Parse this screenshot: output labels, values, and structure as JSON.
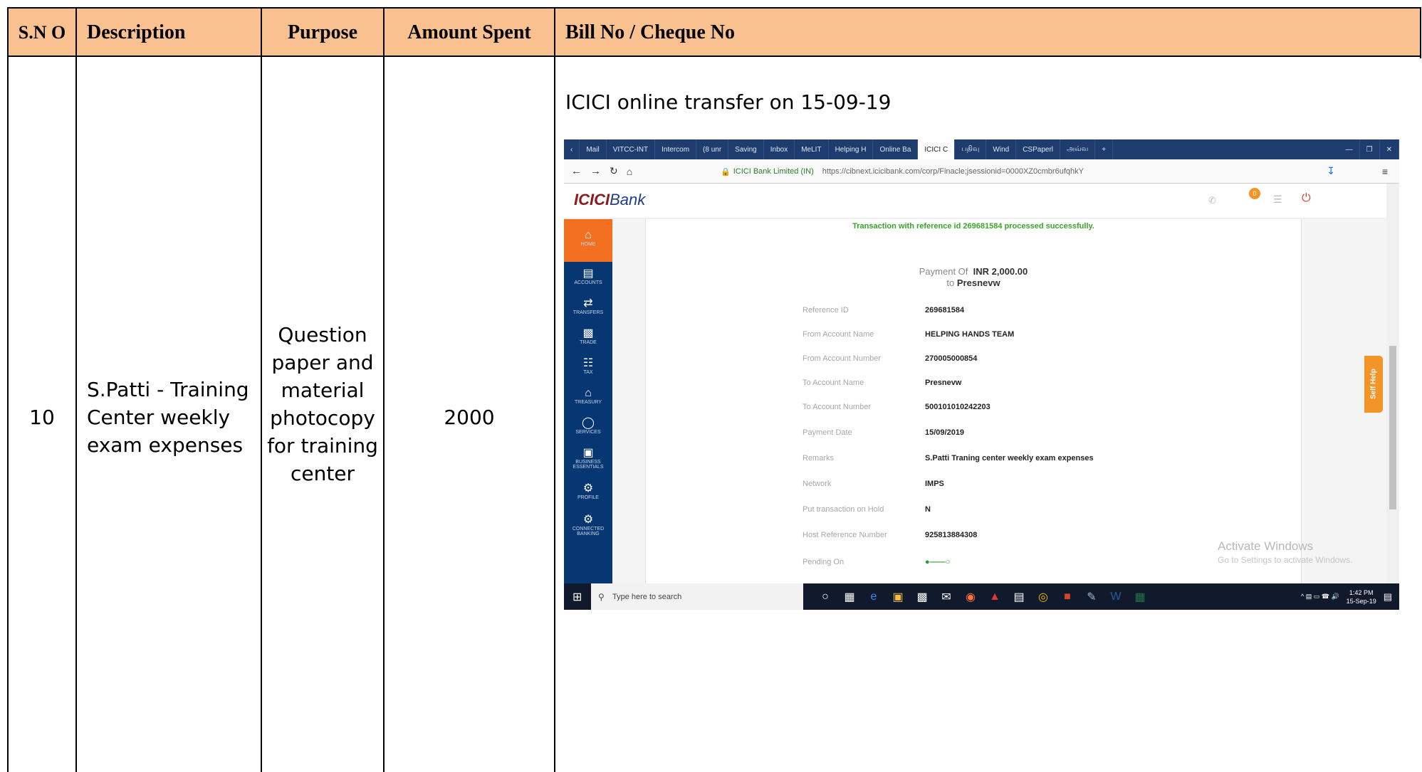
{
  "table": {
    "headers": {
      "sno": "S.N O",
      "description": "Description",
      "purpose": "Purpose",
      "amount": "Amount Spent",
      "bill": "Bill No / Cheque No"
    },
    "row": {
      "sno": "10",
      "description": "S.Patti - Training Center weekly exam expenses",
      "purpose": "Question paper and material photocopy for training center",
      "amount": "2000",
      "bill_caption": "ICICI online transfer on 15-09-19"
    },
    "header_bg": "#f9c090"
  },
  "screenshot": {
    "tabs": [
      "Mail",
      "VITCC-INT",
      "Intercom",
      "(8 unr",
      "Saving",
      "Inbox",
      "MeLIT",
      "Helping H",
      "Online Ba",
      "ICICI C",
      "பதிவு",
      "Wind",
      "CSPaperl",
      "அவ்வ"
    ],
    "address": {
      "site": "ICICI Bank Limited (IN)",
      "url": "https://cibnext.icicibank.com/corp/Finacle;jsessionid=0000XZ0cmbr6ufqhkY"
    },
    "logo": {
      "brand": "ICICI",
      "suffix": "Bank"
    },
    "notification_count": "0",
    "sidebar": [
      "HOME",
      "ACCOUNTS",
      "TRANSFERS",
      "TRADE",
      "TAX",
      "TREASURY",
      "SERVICES",
      "BUSINESS ESSENTIALS",
      "PROFILE",
      "CONNECTED BANKING"
    ],
    "success_message": "Transaction with reference id 269681584 processed successfully.",
    "payment_of_label": "Payment Of",
    "payment_amount": "INR 2,000.00",
    "to_label": "to",
    "payee": "Presnevw",
    "details": [
      {
        "label": "Reference ID",
        "value": "269681584"
      },
      {
        "label": "From Account Name",
        "value": "HELPING HANDS TEAM"
      },
      {
        "label": "From Account Number",
        "value": "270005000854"
      },
      {
        "label": "To Account Name",
        "value": "Presnevw"
      },
      {
        "label": "To Account Number",
        "value": "500101010242203"
      },
      {
        "label": "Payment Date",
        "value": "15/09/2019"
      },
      {
        "label": "Remarks",
        "value": "S.Patti Traning center weekly exam expenses"
      },
      {
        "label": "Network",
        "value": "IMPS"
      },
      {
        "label": "Put transaction on Hold",
        "value": "N"
      },
      {
        "label": "Host Reference Number",
        "value": "925813884308"
      },
      {
        "label": "Pending On",
        "value": ""
      }
    ],
    "watermark_title": "Activate Windows",
    "watermark_sub": "Go to Settings to activate Windows.",
    "self_help": "Self Help",
    "taskbar_search": "Type here to search",
    "time": "1:42 PM",
    "date": "15-Sep-19",
    "accent_orange": "#f37021",
    "sidebar_blue": "#063772",
    "success_green": "#3aa52a"
  }
}
